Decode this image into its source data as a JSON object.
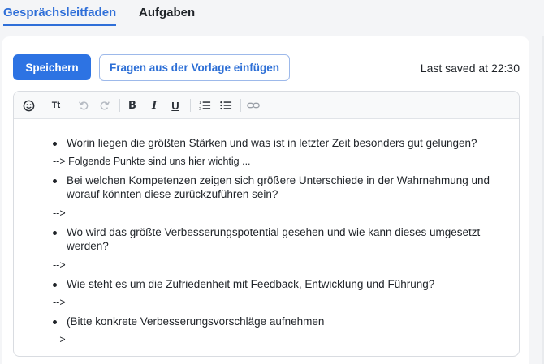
{
  "tabs": [
    {
      "label": "Gesprächsleitfaden",
      "active": true
    },
    {
      "label": "Aufgaben",
      "active": false
    }
  ],
  "actions": {
    "save_label": "Speichern",
    "insert_label": "Fragen aus der Vorlage einfügen",
    "last_saved": "Last saved at 22:30"
  },
  "toolbar": {
    "items": [
      {
        "icon": "emoji-icon"
      },
      {
        "icon": "text-size-icon",
        "label": "Tt"
      },
      {
        "icon": "undo-icon",
        "disabled": true
      },
      {
        "icon": "redo-icon",
        "disabled": true
      },
      {
        "icon": "bold-icon",
        "label": "B"
      },
      {
        "icon": "italic-icon",
        "label": "I"
      },
      {
        "icon": "underline-icon",
        "label": "U"
      },
      {
        "icon": "ordered-list-icon"
      },
      {
        "icon": "bullet-list-icon"
      },
      {
        "icon": "link-icon"
      }
    ]
  },
  "content": {
    "q1": "Worin liegen die größten Stärken und was ist in letzter Zeit besonders gut gelungen?",
    "a1": "--> Folgende Punkte sind uns hier wichtig ...",
    "q2": "Bei welchen Kompetenzen zeigen sich größere Unterschiede in der Wahrnehmung und worauf könnten diese zurückzuführen sein?",
    "a2": "-->",
    "q3": "Wo wird das größte Verbesserungspotential gesehen und wie kann dieses umgesetzt werden?",
    "a3": "-->",
    "q4": "Wie steht es um die Zufriedenheit mit Feedback, Entwicklung und Führung?",
    "a4": "-->",
    "q5": "(Bitte konkrete Verbesserungsvorschläge aufnehmen",
    "a5": "-->"
  },
  "colors": {
    "accent": "#2d73e3",
    "text": "#1f2328",
    "background": "#f4f5f7"
  }
}
